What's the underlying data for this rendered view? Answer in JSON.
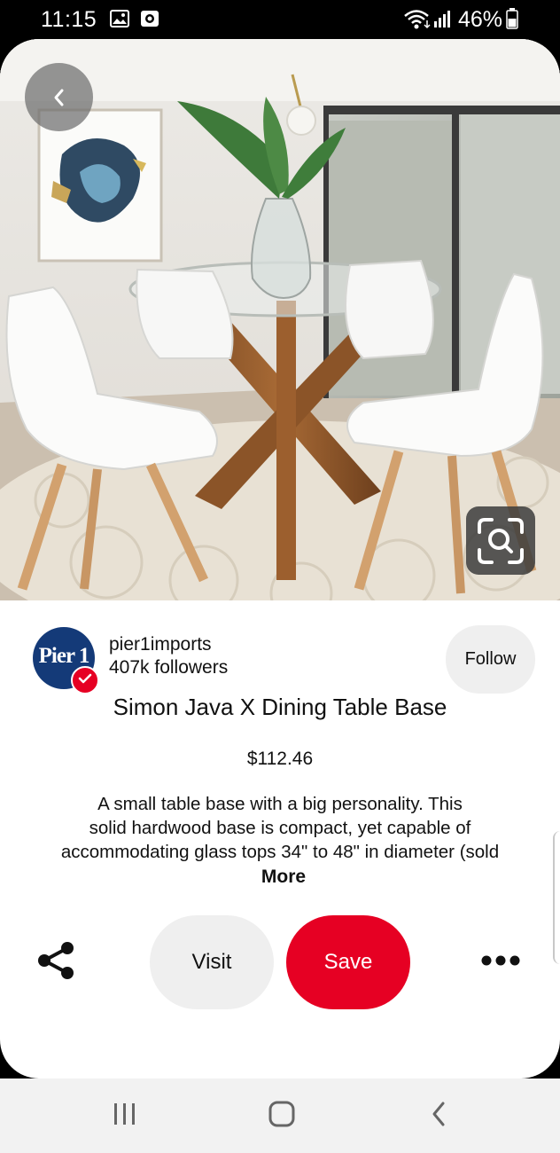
{
  "status_bar": {
    "time": "11:15",
    "battery_percent": "46%",
    "icons": [
      "image-icon",
      "screen-record-icon",
      "wifi-icon",
      "signal-icon",
      "battery-icon"
    ]
  },
  "pin": {
    "image_description": "Round glass dining table on crossed wooden base with white chairs",
    "creator": {
      "name": "pier1imports",
      "followers": "407k followers",
      "avatar_text": "Pier 1",
      "verified": true
    },
    "follow_label": "Follow",
    "title": "Simon Java X Dining Table Base",
    "price": "$112.46",
    "description_lines": [
      "A small table base with a big personality. This",
      "solid hardwood base is compact, yet capable of",
      "accommodating glass tops 34\" to 48\" in diameter (sold"
    ],
    "more_label": "More"
  },
  "actions": {
    "visit_label": "Visit",
    "save_label": "Save"
  },
  "colors": {
    "accent": "#e60023",
    "secondary_button": "#efefef",
    "avatar_bg": "#143a78"
  }
}
